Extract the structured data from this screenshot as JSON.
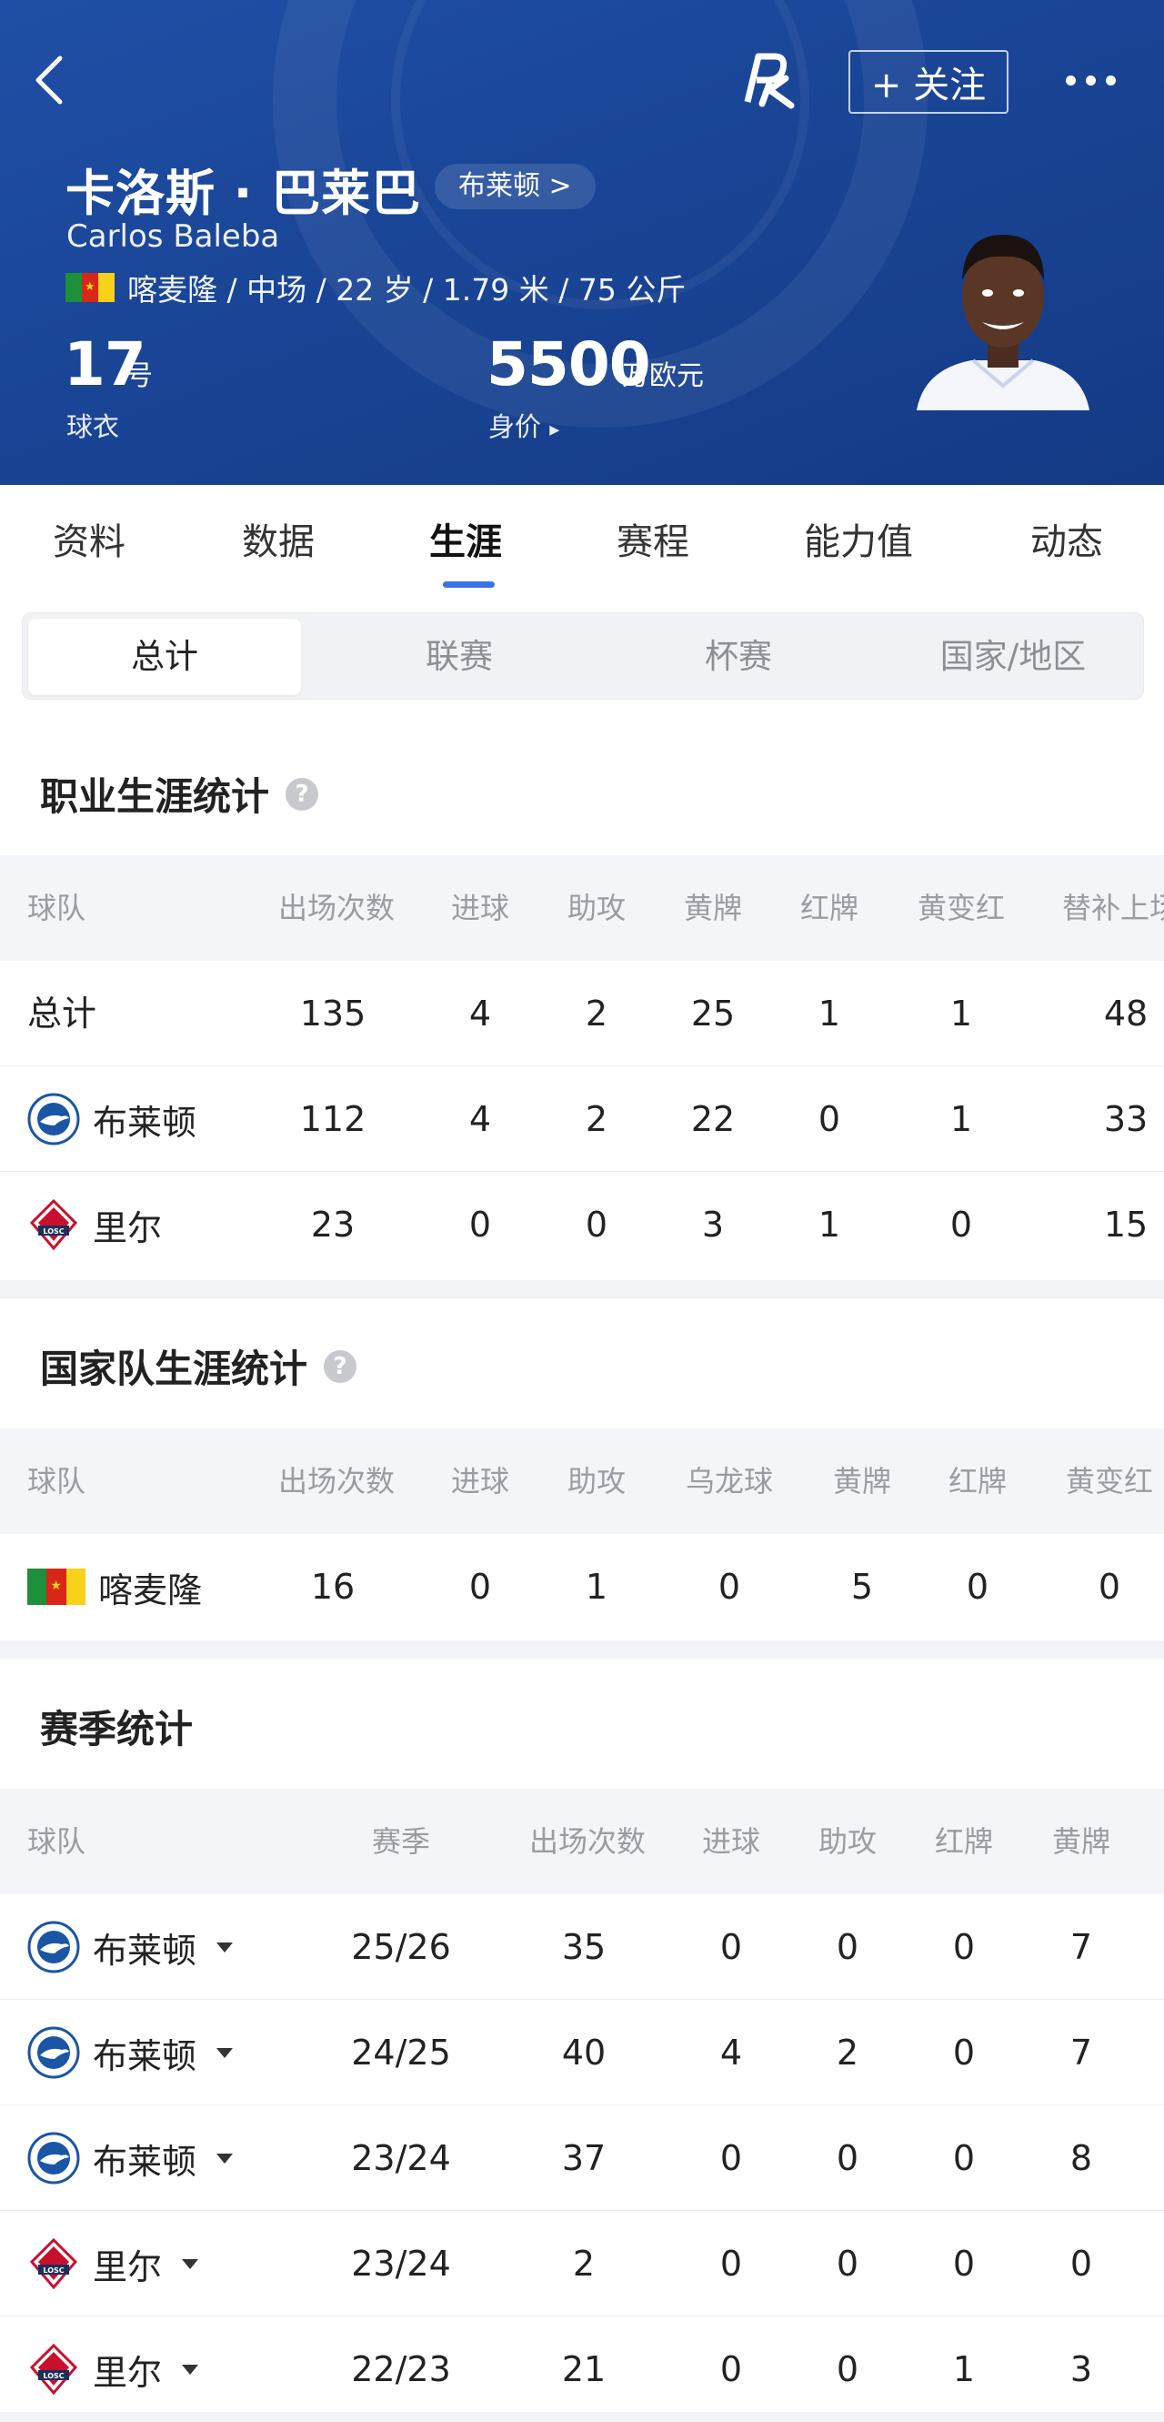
{
  "header": {
    "follow_label": "+ 关注",
    "logo_text": "PK",
    "player_name": "卡洛斯 · 巴莱巴",
    "team_link": "布莱顿 >",
    "name_en": "Carlos Baleba",
    "info": "喀麦隆 / 中场 / 22 岁 / 1.79 米 / 75 公斤",
    "jersey_number": "17",
    "jersey_unit": "号",
    "jersey_label": "球衣",
    "value_number": "5500",
    "value_unit": "万欧元",
    "value_label": "身价",
    "value_arrow": "▸"
  },
  "tabs": [
    {
      "label": "资料"
    },
    {
      "label": "数据"
    },
    {
      "label": "生涯"
    },
    {
      "label": "赛程"
    },
    {
      "label": "能力值"
    },
    {
      "label": "动态"
    }
  ],
  "segments": [
    {
      "label": "总计"
    },
    {
      "label": "联赛"
    },
    {
      "label": "杯赛"
    },
    {
      "label": "国家/地区"
    }
  ],
  "career": {
    "title": "职业生涯统计",
    "help": "?",
    "headers": [
      "球队",
      "出场次数",
      "进球",
      "助攻",
      "黄牌",
      "红牌",
      "黄变红",
      "替补上场"
    ],
    "rows": [
      {
        "team": "总计",
        "vals": [
          "135",
          "4",
          "2",
          "25",
          "1",
          "1",
          "48"
        ]
      },
      {
        "team": "布莱顿",
        "vals": [
          "112",
          "4",
          "2",
          "22",
          "0",
          "1",
          "33"
        ]
      },
      {
        "team": "里尔",
        "vals": [
          "23",
          "0",
          "0",
          "3",
          "1",
          "0",
          "15"
        ]
      }
    ]
  },
  "national": {
    "title": "国家队生涯统计",
    "help": "?",
    "headers": [
      "球队",
      "出场次数",
      "进球",
      "助攻",
      "乌龙球",
      "黄牌",
      "红牌",
      "黄变红"
    ],
    "rows": [
      {
        "team": "喀麦隆",
        "vals": [
          "16",
          "0",
          "1",
          "0",
          "5",
          "0",
          "0"
        ]
      }
    ]
  },
  "season": {
    "title": "赛季统计",
    "headers": [
      "球队",
      "赛季",
      "出场次数",
      "进球",
      "助攻",
      "红牌",
      "黄牌"
    ],
    "rows": [
      {
        "team": "布莱顿",
        "season": "25/26",
        "vals": [
          "35",
          "0",
          "0",
          "0",
          "7"
        ]
      },
      {
        "team": "布莱顿",
        "season": "24/25",
        "vals": [
          "40",
          "4",
          "2",
          "0",
          "7"
        ]
      },
      {
        "team": "布莱顿",
        "season": "23/24",
        "vals": [
          "37",
          "0",
          "0",
          "0",
          "8"
        ]
      },
      {
        "team": "里尔",
        "season": "23/24",
        "vals": [
          "2",
          "0",
          "0",
          "0",
          "0"
        ]
      },
      {
        "team": "里尔",
        "season": "22/23",
        "vals": [
          "21",
          "0",
          "0",
          "1",
          "3"
        ]
      }
    ]
  },
  "colors": {
    "header_bg": "#1a4596",
    "accent": "#3a74e8",
    "cameroon_green": "#1e8f3a",
    "cameroon_red": "#d62718",
    "cameroon_yellow": "#f7d11a",
    "lille_red": "#c8102e"
  }
}
